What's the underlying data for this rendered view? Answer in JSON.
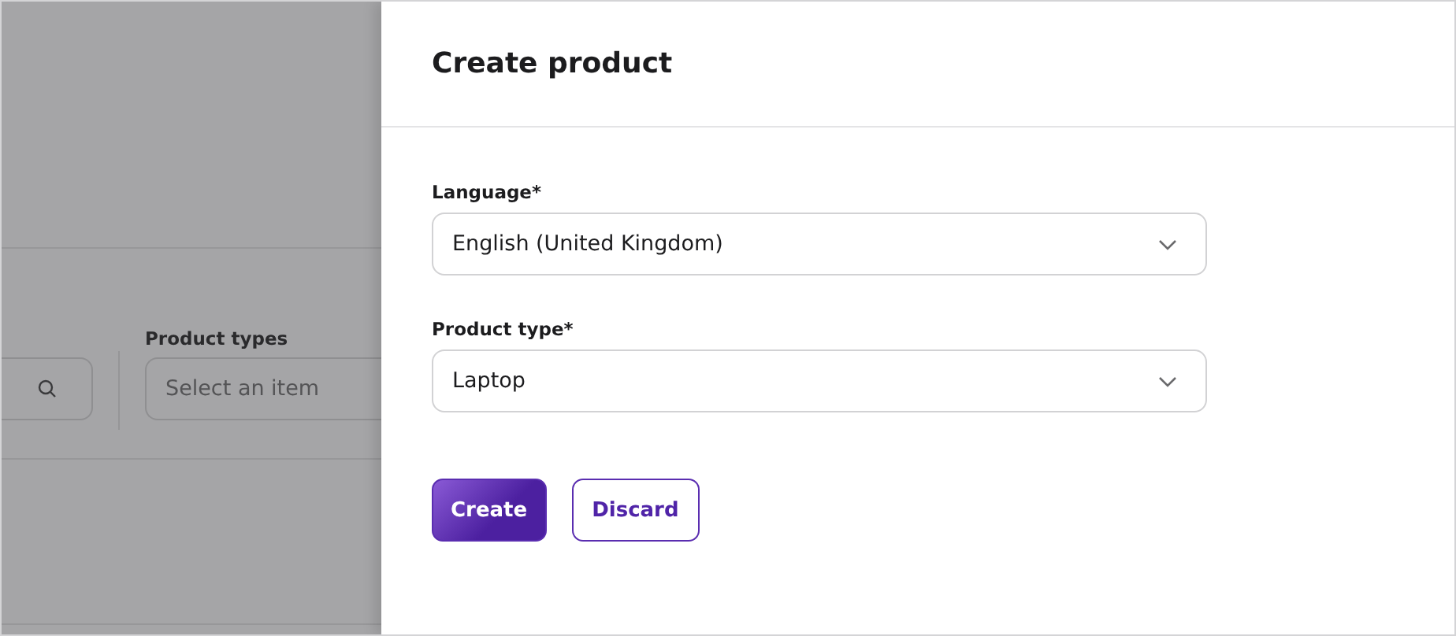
{
  "background_page": {
    "product_types": {
      "label": "Product types",
      "placeholder": "Select an item"
    }
  },
  "drawer": {
    "title": "Create product",
    "fields": [
      {
        "label": "Language*",
        "value": "English (United Kingdom)"
      },
      {
        "label": "Product type*",
        "value": "Laptop"
      }
    ],
    "buttons": [
      {
        "label": "Create",
        "kind": "primary"
      },
      {
        "label": "Discard",
        "kind": "secondary"
      }
    ]
  }
}
